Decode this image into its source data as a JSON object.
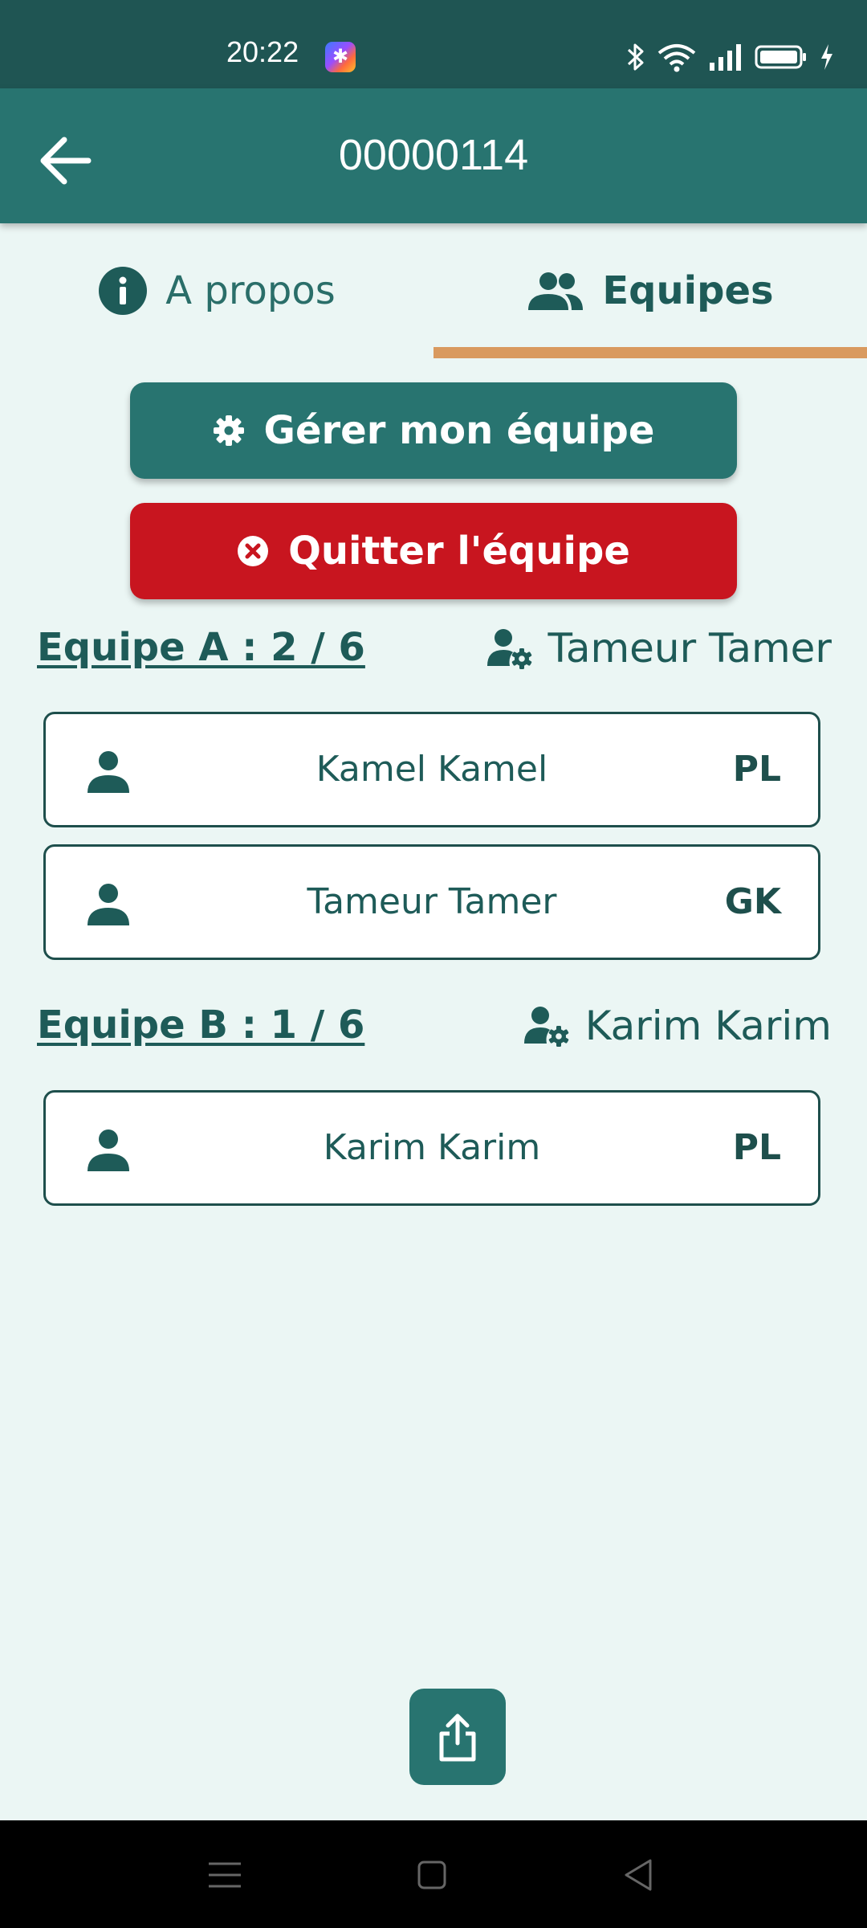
{
  "status_bar": {
    "time": "20:22",
    "icons": [
      "app-notification-icon",
      "bluetooth-icon",
      "wifi-icon",
      "signal-icon",
      "battery-icon",
      "charging-icon"
    ]
  },
  "app_bar": {
    "title": "00000114",
    "back_icon": "arrow-left-icon"
  },
  "tabs": [
    {
      "label": "A propos",
      "icon": "info-icon",
      "selected": false
    },
    {
      "label": "Equipes",
      "icon": "group-icon",
      "selected": true
    }
  ],
  "actions": {
    "manage_label": "Gérer mon équipe",
    "quit_label": "Quitter l'équipe"
  },
  "teams": [
    {
      "title": "Equipe A : 2 / 6",
      "captain": "Tameur Tamer",
      "players": [
        {
          "name": "Kamel Kamel",
          "position": "PL"
        },
        {
          "name": "Tameur Tamer",
          "position": "GK"
        }
      ]
    },
    {
      "title": "Equipe B : 1 / 6",
      "captain": "Karim Karim",
      "players": [
        {
          "name": "Karim Karim",
          "position": "PL"
        }
      ]
    }
  ],
  "colors": {
    "primary": "#287470",
    "status_bar": "#1f5553",
    "background": "#ebf6f4",
    "danger": "#c8151f",
    "tab_indicator": "#d99a5f",
    "text": "#1e5b58"
  }
}
